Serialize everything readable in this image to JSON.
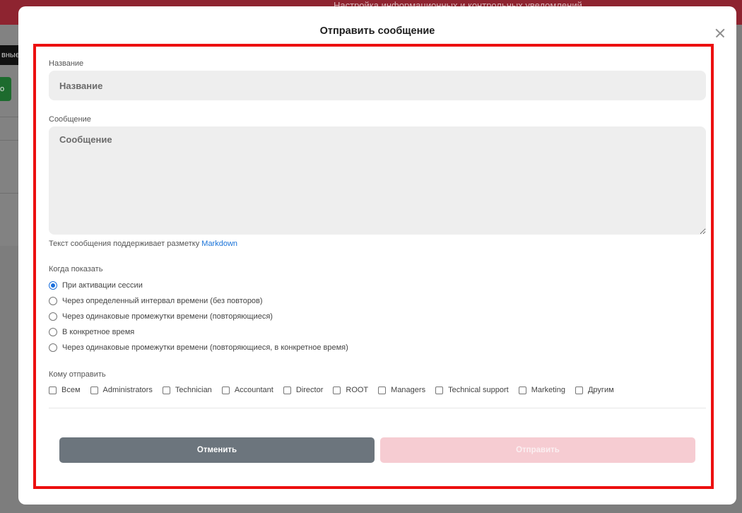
{
  "background": {
    "topbar_text": "Настройка информационных и контрольных уведомлений",
    "black_tab_text": "вные",
    "green_button_text": "о"
  },
  "modal": {
    "title": "Отправить сообщение",
    "name_field": {
      "label": "Название",
      "placeholder": "Название",
      "value": ""
    },
    "message_field": {
      "label": "Сообщение",
      "placeholder": "Сообщение",
      "value": ""
    },
    "markdown_hint": {
      "text": "Текст сообщения поддерживает разметку ",
      "link": "Markdown"
    },
    "when_to_show": {
      "label": "Когда показать",
      "options": [
        {
          "label": "При активации сессии",
          "checked": true
        },
        {
          "label": "Через определенный интервал времени (без повторов)",
          "checked": false
        },
        {
          "label": "Через одинаковые промежутки времени (повторяющиеся)",
          "checked": false
        },
        {
          "label": "В конкретное время",
          "checked": false
        },
        {
          "label": "Через одинаковые промежутки времени (повторяющиеся, в конкретное время)",
          "checked": false
        }
      ]
    },
    "recipients": {
      "label": "Кому отправить",
      "options": [
        {
          "label": "Всем",
          "checked": false
        },
        {
          "label": "Administrators",
          "checked": false
        },
        {
          "label": "Technician",
          "checked": false
        },
        {
          "label": "Accountant",
          "checked": false
        },
        {
          "label": "Director",
          "checked": false
        },
        {
          "label": "ROOT",
          "checked": false
        },
        {
          "label": "Managers",
          "checked": false
        },
        {
          "label": "Technical support",
          "checked": false
        },
        {
          "label": "Marketing",
          "checked": false
        },
        {
          "label": "Другим",
          "checked": false
        }
      ]
    },
    "buttons": {
      "cancel": "Отменить",
      "send": "Отправить"
    }
  },
  "colors": {
    "highlight_border": "#ec0f0f",
    "radio_accent": "#1a6fdc",
    "link": "#1a73d8",
    "cancel_button": "#6c757d",
    "send_button_disabled": "#f6ccd2"
  }
}
